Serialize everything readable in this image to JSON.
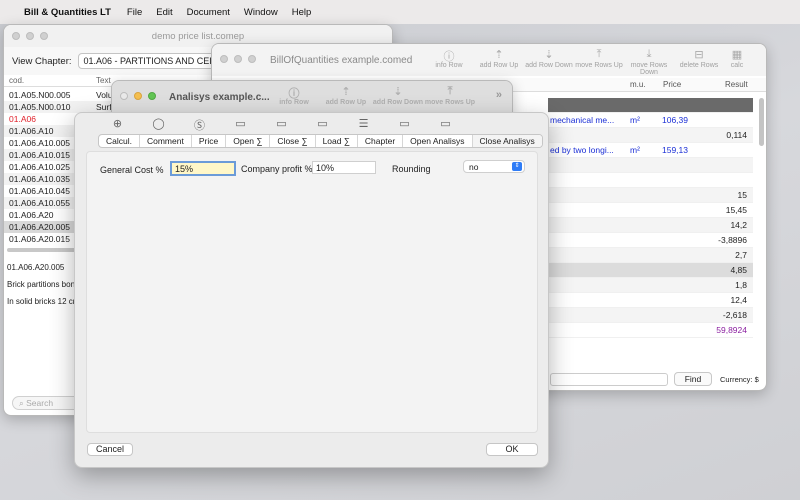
{
  "menubar": {
    "app": "Bill & Quantities LT",
    "items": [
      "File",
      "Edit",
      "Document",
      "Window",
      "Help"
    ]
  },
  "price_list": {
    "title": "demo price list.comep",
    "chapter_label": "View Chapter:",
    "chapter_value": "01.A06 - PARTITIONS AND CEILINGS",
    "columns": [
      "cod.",
      "Text"
    ],
    "rows": [
      {
        "code": "01.A05.N00.005",
        "text": "Volu"
      },
      {
        "code": "01.A05.N00.010",
        "text": "Surf"
      },
      {
        "code": "01.A06",
        "text": ""
      },
      {
        "code": "01.A06.A10",
        "text": ""
      },
      {
        "code": "01.A06.A10.005",
        "text": ""
      },
      {
        "code": "01.A06.A10.015",
        "text": ""
      },
      {
        "code": "01.A06.A10.025",
        "text": ""
      },
      {
        "code": "01.A06.A10.035",
        "text": ""
      },
      {
        "code": "01.A06.A10.045",
        "text": ""
      },
      {
        "code": "01.A06.A10.055",
        "text": ""
      },
      {
        "code": "01.A06.A20",
        "text": ""
      },
      {
        "code": "01.A06.A20.005",
        "text": ""
      },
      {
        "code": "01.A06.A20.015",
        "text": ""
      }
    ],
    "detail_code": "01.A06.A20.005",
    "detail_text1": "Brick partitions bonde",
    "detail_text2": "In solid bricks 12 cm",
    "search_placeholder": "Search"
  },
  "boq": {
    "title": "BillOfQuantities example.comed",
    "toolbar": [
      "info Row",
      "add Row Up",
      "add Row Down",
      "move Rows Up",
      "move Rows Down",
      "delete Rows",
      "calc"
    ],
    "columns": {
      "mu": "m.u.",
      "price": "Price",
      "result": "Result"
    },
    "desc1": "mechanical me...",
    "desc2": "ed by two longi...",
    "rows": [
      {
        "mu": "",
        "price": "",
        "result": ""
      },
      {
        "mu": "m²",
        "price": "106,39",
        "result": ""
      },
      {
        "mu": "",
        "price": "",
        "result": "0,114"
      },
      {
        "mu": "m²",
        "price": "159,13",
        "result": ""
      },
      {
        "mu": "",
        "price": "",
        "result": ""
      },
      {
        "mu": "",
        "price": "",
        "result": ""
      },
      {
        "mu": "",
        "price": "",
        "result": "15"
      },
      {
        "mu": "",
        "price": "",
        "result": "15,45"
      },
      {
        "mu": "",
        "price": "",
        "result": "14,2"
      },
      {
        "mu": "",
        "price": "",
        "result": "-3,8896"
      },
      {
        "mu": "",
        "price": "",
        "result": "2,7"
      },
      {
        "mu": "",
        "price": "",
        "result": "4,85"
      },
      {
        "mu": "",
        "price": "",
        "result": "1,8"
      },
      {
        "mu": "",
        "price": "",
        "result": "12,4"
      },
      {
        "mu": "",
        "price": "",
        "result": "-2,618"
      },
      {
        "mu": "",
        "price": "",
        "result": "59,8924"
      }
    ],
    "find_label": "Find",
    "currency": "Currency: $"
  },
  "analysis": {
    "title": "Analisys example.c...",
    "toolbar": [
      "info Row",
      "add Row Up",
      "add Row Down",
      "move Rows Up"
    ]
  },
  "sheet": {
    "tabs": [
      "Calcul.",
      "Comment",
      "Price",
      "Open ∑",
      "Close ∑",
      "Load ∑",
      "Chapter",
      "Open Analisys",
      "Close Analisys"
    ],
    "general_cost_label": "General Cost %",
    "general_cost_value": "15%",
    "profit_label": "Company profit %",
    "profit_value": "10%",
    "rounding_label": "Rounding",
    "rounding_value": "no",
    "cancel": "Cancel",
    "ok": "OK"
  },
  "colors": {
    "accent": "#2f7cf6",
    "link_blue": "#1b2fd6",
    "red": "#e0202a",
    "purple": "#8b1fa0"
  }
}
